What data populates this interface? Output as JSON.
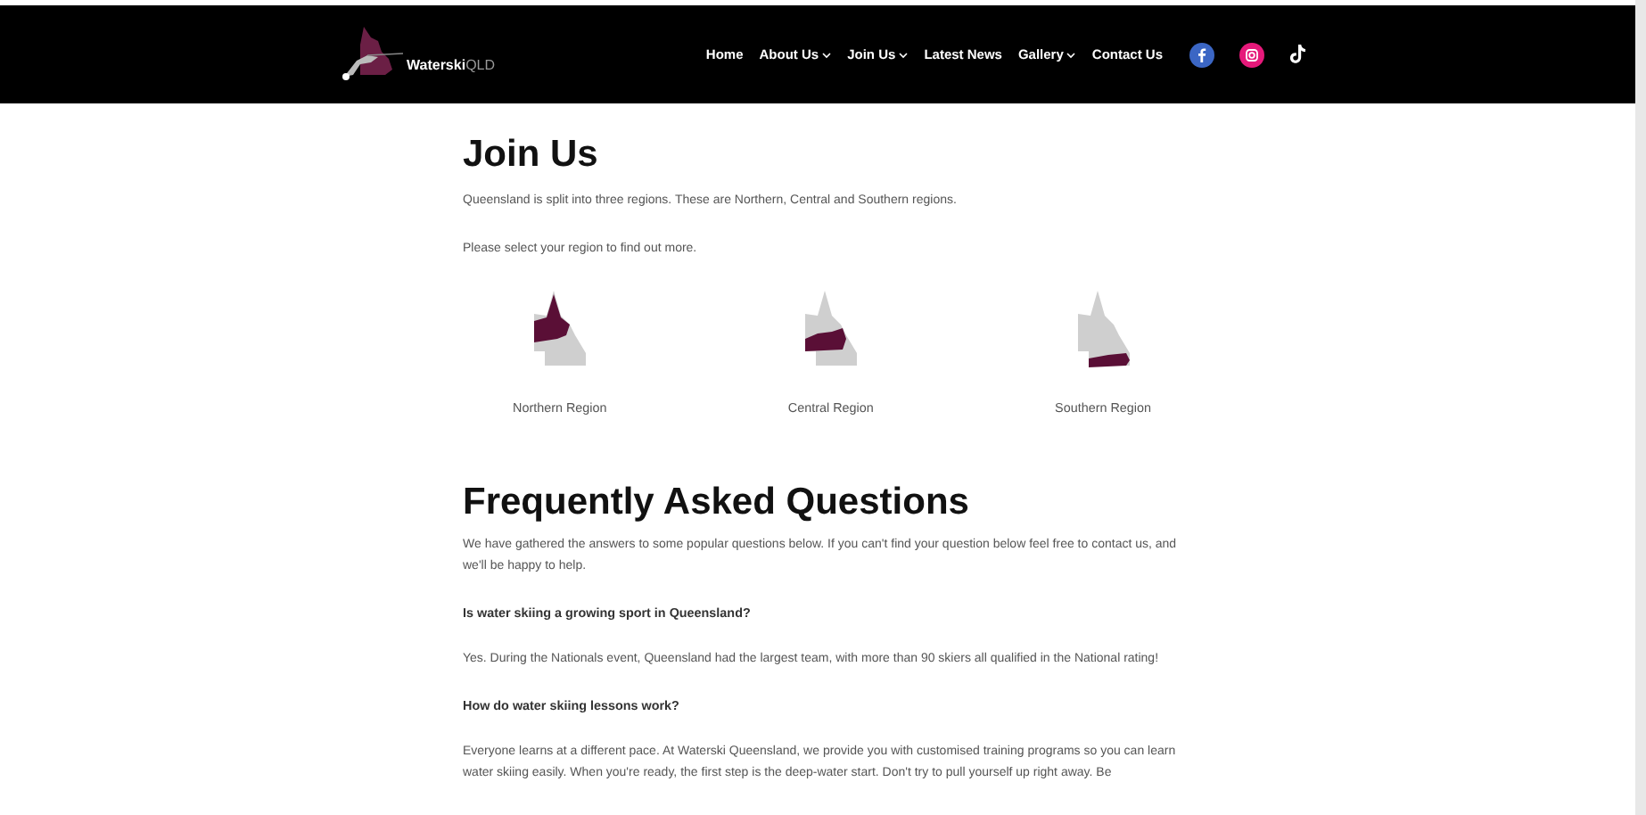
{
  "header": {
    "logo": {
      "name": "Waterski",
      "suffix": "QLD"
    },
    "nav": [
      {
        "label": "Home",
        "dropdown": false
      },
      {
        "label": "About Us",
        "dropdown": true
      },
      {
        "label": "Join Us",
        "dropdown": true
      },
      {
        "label": "Latest News",
        "dropdown": false
      },
      {
        "label": "Gallery",
        "dropdown": true
      },
      {
        "label": "Contact Us",
        "dropdown": false
      }
    ]
  },
  "join": {
    "title": "Join Us",
    "paragraphs": [
      "Queensland is split into three regions. These are Northern, Central and Southern regions.",
      "Please select your region to find out more."
    ],
    "regions": [
      {
        "label": "Northern Region",
        "kind": "north"
      },
      {
        "label": "Central Region",
        "kind": "central"
      },
      {
        "label": "Southern Region",
        "kind": "south"
      }
    ]
  },
  "faq": {
    "title": "Frequently Asked Questions",
    "items": [
      {
        "kind": "text",
        "text": "We have gathered the answers to some popular questions below. If you can't find your question below feel free to contact us, and we'll be happy to help."
      },
      {
        "kind": "question",
        "text": "Is water skiing a growing sport in Queensland?"
      },
      {
        "kind": "text",
        "text": "Yes. During the Nationals event, Queensland had the largest team, with more than 90 skiers all qualified in the National rating!"
      },
      {
        "kind": "question",
        "text": "How do water skiing lessons work?"
      },
      {
        "kind": "text",
        "text": "Everyone learns at a different pace. At Waterski Queensland, we provide you with customised training programs so you can learn water skiing easily. When you're ready, the first step is the deep-water start. Don't try to pull yourself up right away. Be"
      }
    ]
  }
}
